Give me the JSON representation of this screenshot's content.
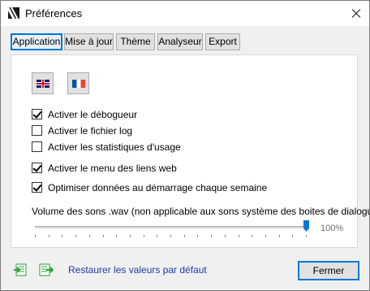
{
  "window": {
    "title": "Préférences"
  },
  "tabs": [
    {
      "label": "Application",
      "active": true
    },
    {
      "label": "Mise à jour",
      "active": false
    },
    {
      "label": "Thème",
      "active": false
    },
    {
      "label": "Analyseur",
      "active": false
    },
    {
      "label": "Export",
      "active": false
    }
  ],
  "language_buttons": [
    {
      "icon": "uk-flag-icon",
      "language": "English"
    },
    {
      "icon": "france-flag-icon",
      "language": "Français"
    }
  ],
  "options": [
    {
      "label": "Activer le débogueur",
      "checked": true
    },
    {
      "label": "Activer le fichier log",
      "checked": false
    },
    {
      "label": "Activer les statistiques d'usage",
      "checked": false
    },
    {
      "label": "Activer le menu des liens web",
      "checked": true
    },
    {
      "label": "Optimiser données au démarrage chaque semaine",
      "checked": true
    }
  ],
  "volume": {
    "label": "Volume des sons .wav (non applicable aux sons système des boites de dialogue)",
    "value_percent": 100,
    "value_text": "100%"
  },
  "footer": {
    "import_icon": "import-icon",
    "export_icon": "export-icon",
    "restore_label": "Restaurer les valeurs par défaut",
    "close_label": "Fermer"
  },
  "colors": {
    "accent": "#0078d7",
    "link": "#1f3aa8",
    "icon_green": "#2e9e3a"
  }
}
